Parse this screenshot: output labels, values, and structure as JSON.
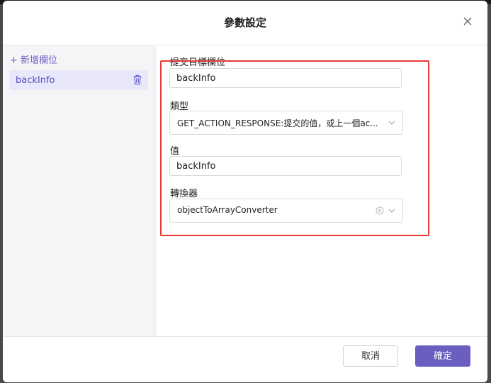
{
  "dialog": {
    "title": "參數設定"
  },
  "sidebar": {
    "add_label": "+ 新增欄位",
    "items": [
      {
        "label": "backInfo"
      }
    ]
  },
  "form": {
    "target_field": {
      "label": "提交目標欄位",
      "value": "backInfo"
    },
    "type": {
      "label": "類型",
      "value": "GET_ACTION_RESPONSE:提交的值，或上一個ac..."
    },
    "value": {
      "label": "值",
      "value": "backInfo"
    },
    "converter": {
      "label": "轉換器",
      "value": "objectToArrayConverter"
    }
  },
  "footer": {
    "cancel_label": "取消",
    "ok_label": "確定"
  },
  "colors": {
    "accent": "#6a5fc1",
    "highlight": "#e53935"
  }
}
